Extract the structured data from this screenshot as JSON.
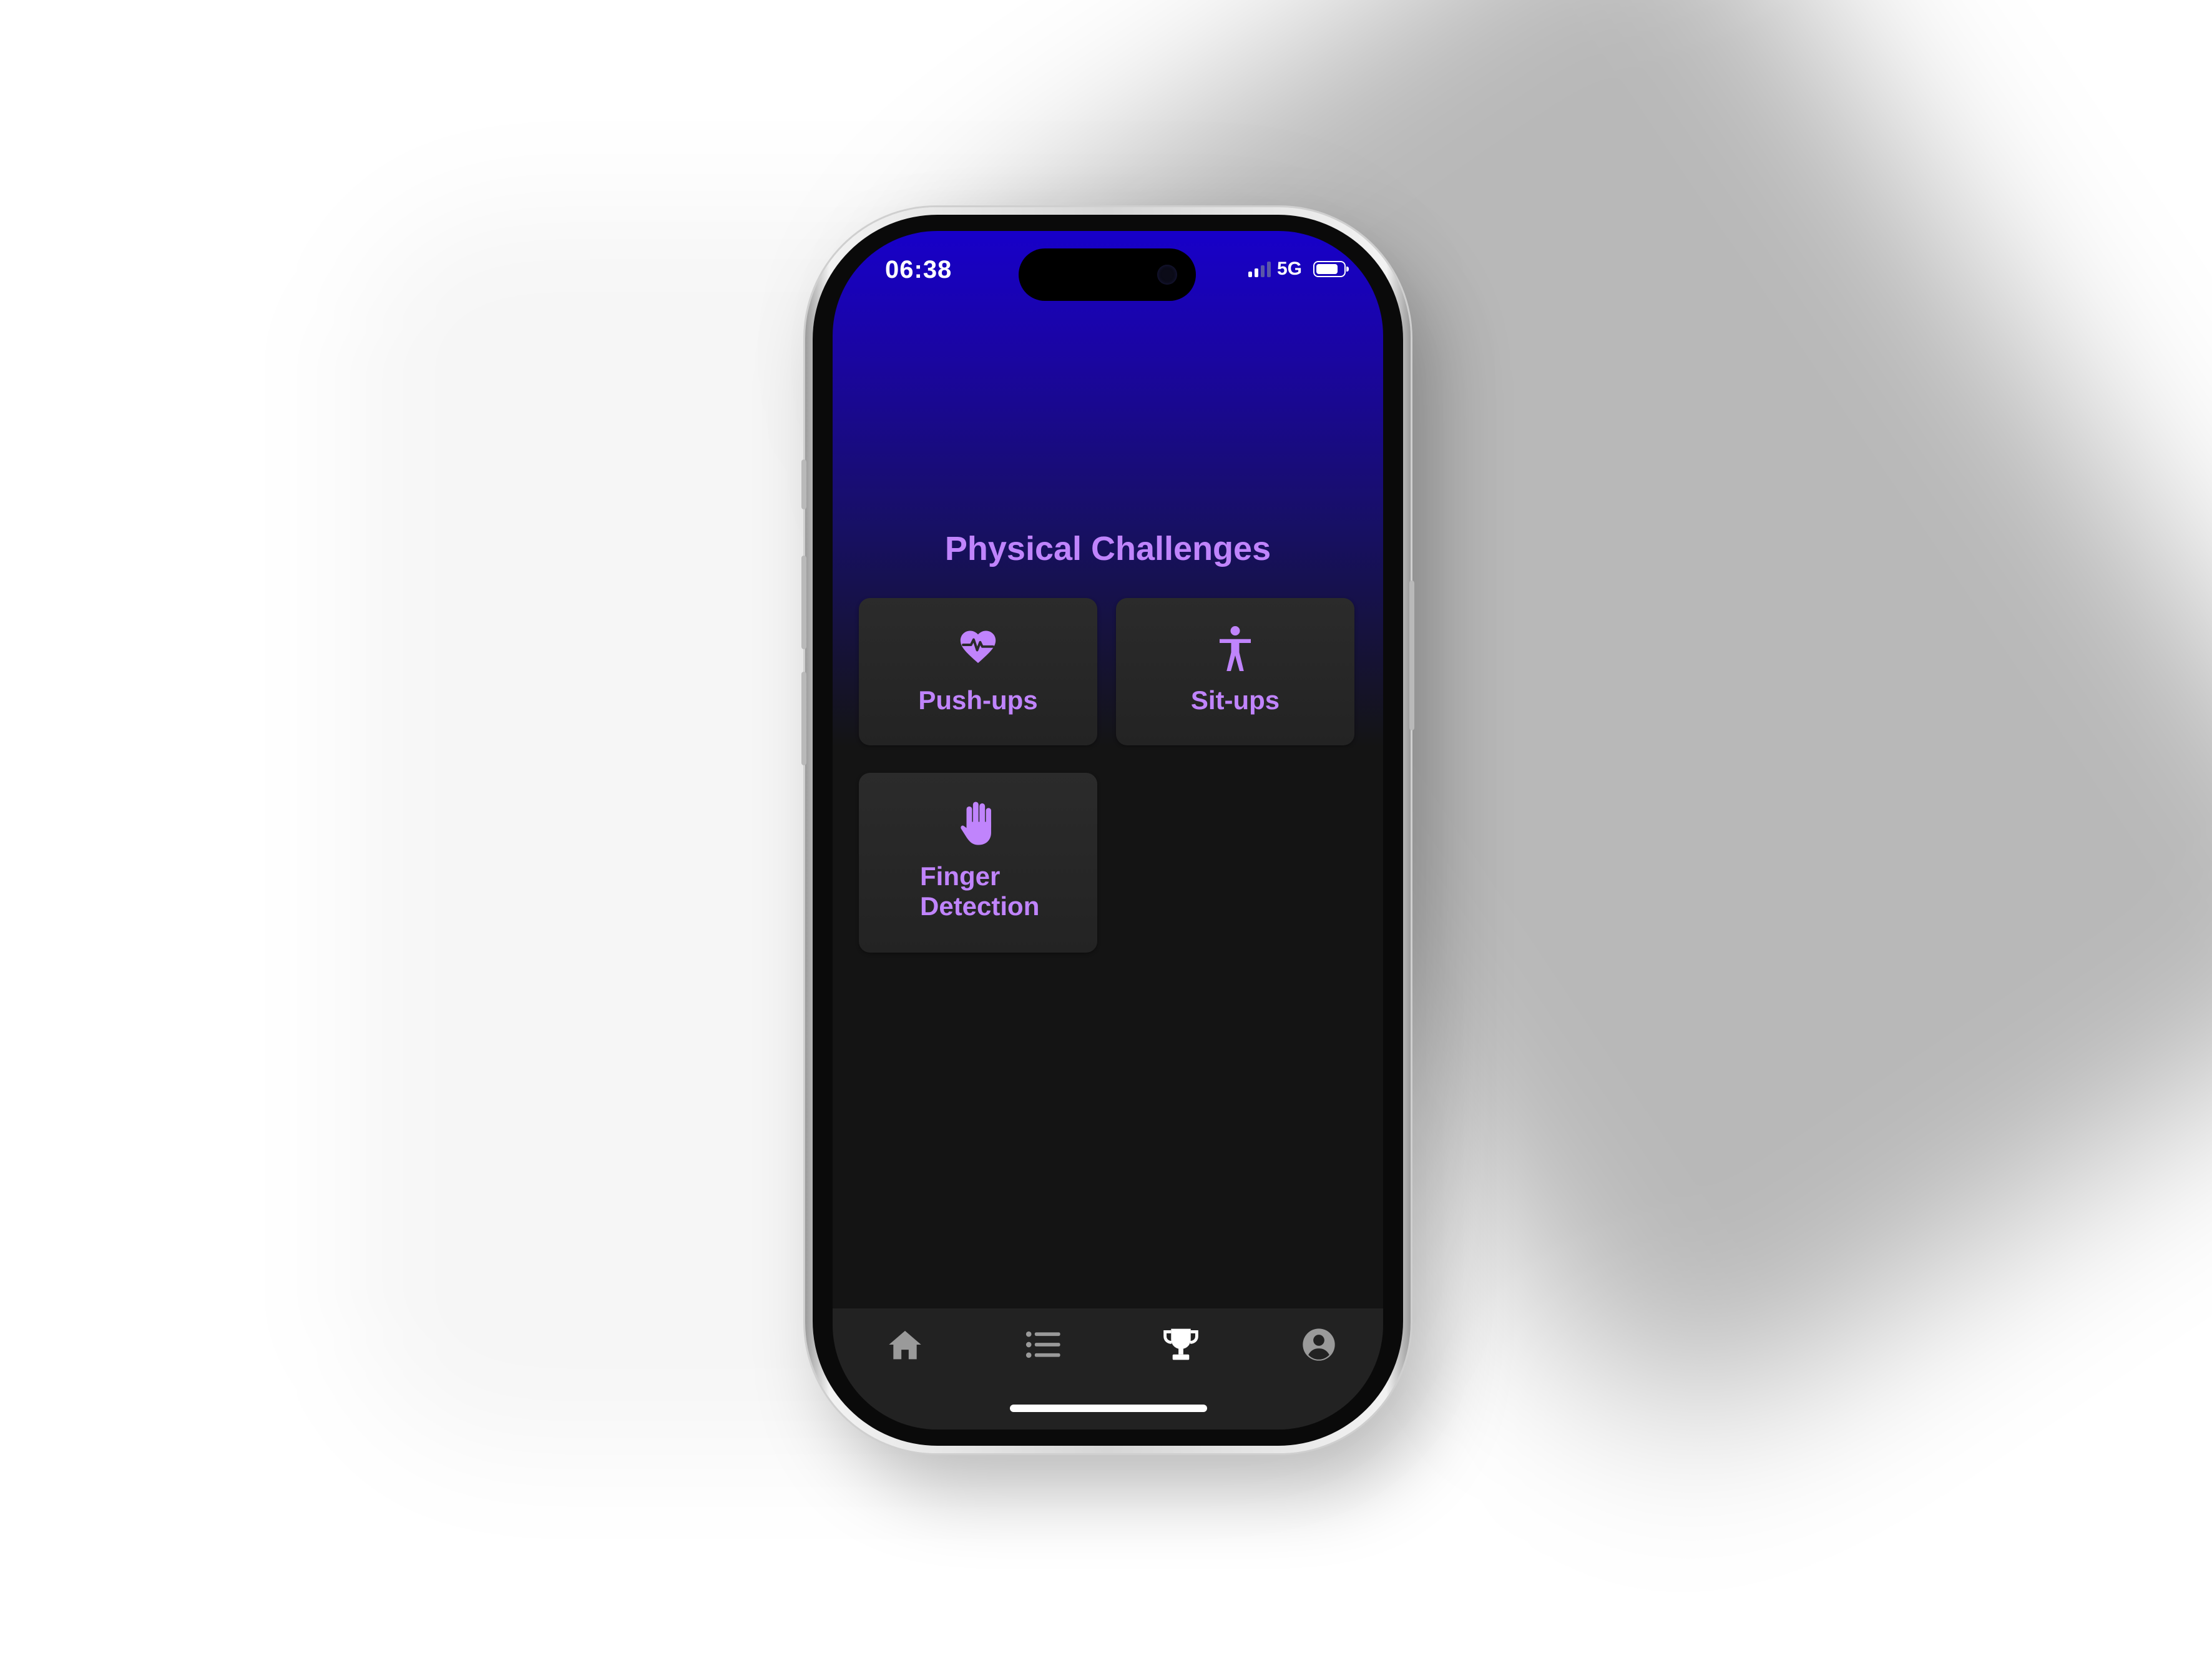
{
  "status_bar": {
    "time": "06:38",
    "network": "5G",
    "signal_icon": "signal-bars-icon",
    "battery_icon": "battery-icon"
  },
  "main": {
    "title": "Physical Challenges",
    "cards": [
      {
        "label": "Push-ups",
        "icon": "heart-pulse-icon"
      },
      {
        "label": "Sit-ups",
        "icon": "person-figure-icon"
      },
      {
        "label": "Finger Detection",
        "icon": "raised-hand-icon"
      }
    ]
  },
  "tab_bar": {
    "tabs": [
      {
        "icon": "home-icon",
        "active": false
      },
      {
        "icon": "list-icon",
        "active": false
      },
      {
        "icon": "trophy-icon",
        "active": true
      },
      {
        "icon": "profile-icon",
        "active": false
      }
    ]
  },
  "colors": {
    "accent": "#c084fc",
    "header_gradient_top": "#1700c9",
    "background": "#141414",
    "card": "#2b2b2b",
    "tab_bar": "#222222",
    "tab_inactive": "#9a9a9a",
    "tab_active": "#ffffff"
  }
}
